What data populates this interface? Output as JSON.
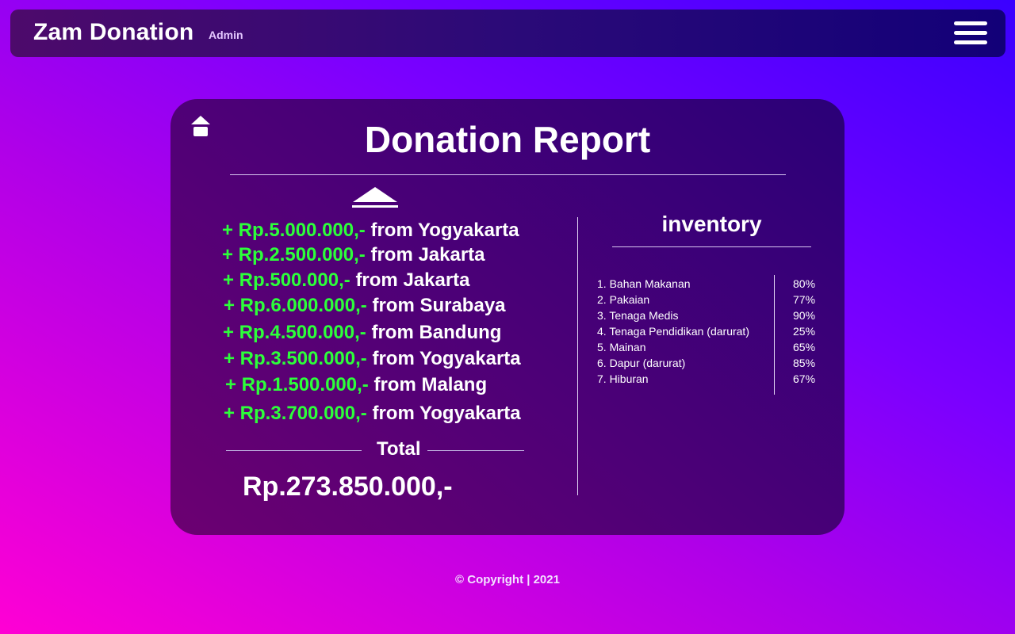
{
  "header": {
    "brand": "Zam Donation",
    "role": "Admin"
  },
  "report": {
    "title": "Donation Report",
    "donations": [
      {
        "amount": "+ Rp.5.000.000,-",
        "source": "from Yogyakarta"
      },
      {
        "amount": "+ Rp.2.500.000,-",
        "source": "from Jakarta"
      },
      {
        "amount": "+ Rp.500.000,-",
        "source": "from Jakarta"
      },
      {
        "amount": "+ Rp.6.000.000,-",
        "source": "from Surabaya"
      },
      {
        "amount": "+ Rp.4.500.000,-",
        "source": "from Bandung"
      },
      {
        "amount": "+ Rp.3.500.000,-",
        "source": "from Yogyakarta"
      },
      {
        "amount": "+ Rp.1.500.000,-",
        "source": "from Malang"
      },
      {
        "amount": "+ Rp.3.700.000,-",
        "source": "from Yogyakarta"
      }
    ],
    "total_label": "Total",
    "total_amount": "Rp.273.850.000,-"
  },
  "inventory": {
    "title": "inventory",
    "items": [
      {
        "name": "1. Bahan Makanan",
        "percent": "80%"
      },
      {
        "name": "2. Pakaian",
        "percent": "77%"
      },
      {
        "name": "3. Tenaga Medis",
        "percent": "90%"
      },
      {
        "name": "4. Tenaga Pendidikan (darurat)",
        "percent": "25%"
      },
      {
        "name": "5. Mainan",
        "percent": "65%"
      },
      {
        "name": "6. Dapur (darurat)",
        "percent": "85%"
      },
      {
        "name": "7. Hiburan",
        "percent": "67%"
      }
    ]
  },
  "icons": {
    "menu": "hamburger-menu-icon",
    "home": "home-icon",
    "collapse": "chevron-up-icon"
  },
  "colors": {
    "amount_green": "#2cff3a",
    "text": "#ffffff"
  },
  "footer": {
    "text": "© Copyright | 2021"
  }
}
